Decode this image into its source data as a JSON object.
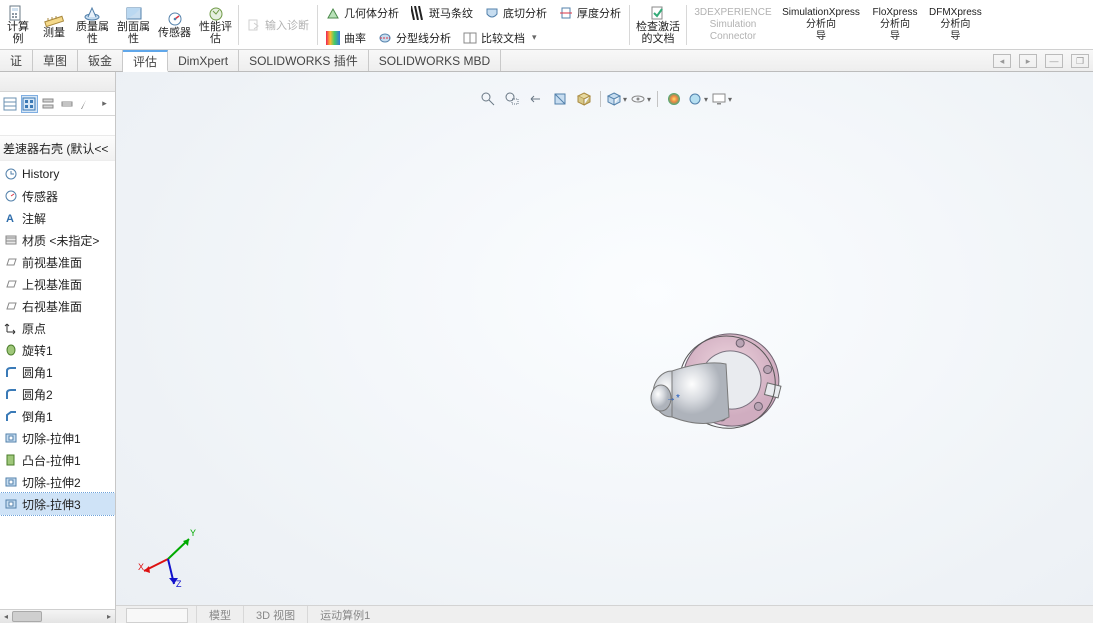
{
  "ribbon": {
    "items": [
      {
        "label": "计算\n例",
        "icon": "calc"
      },
      {
        "label": "测量",
        "icon": "measure"
      },
      {
        "label": "质量属\n性",
        "icon": "massprops"
      },
      {
        "label": "剖面属\n性",
        "icon": "sectionprops"
      },
      {
        "label": "传感器",
        "icon": "sensor"
      },
      {
        "label": "性能评\n估",
        "icon": "performance"
      }
    ],
    "input_diag": "输入诊断",
    "geom": "几何体分析",
    "zebra": "斑马条纹",
    "undercut": "底切分析",
    "thickness": "厚度分析",
    "curvature": "曲率",
    "partingline": "分型线分析",
    "compare": "比较文档",
    "check_doc": "检查激活\n的文档",
    "threeDX": {
      "l1": "3DEXPERIENCE",
      "l2": "Simulation",
      "l3": "Connector"
    },
    "simx": {
      "l1": "SimulationXpress",
      "l2": "分析向",
      "l3": "导"
    },
    "flox": {
      "l1": "FloXpress",
      "l2": "分析向",
      "l3": "导"
    },
    "dfmx": {
      "l1": "DFMXpress",
      "l2": "分析向",
      "l3": "导"
    }
  },
  "cm_tabs": [
    "证",
    "草图",
    "钣金",
    "评估",
    "DimXpert",
    "SOLIDWORKS 插件",
    "SOLIDWORKS MBD"
  ],
  "cm_active": 3,
  "tree": {
    "title": "差速器右壳  (默认<<",
    "items": [
      {
        "icon": "history",
        "label": "History"
      },
      {
        "icon": "sensor",
        "label": "传感器"
      },
      {
        "icon": "annotation",
        "label": "注解"
      },
      {
        "icon": "material",
        "label": "材质 <未指定>"
      },
      {
        "icon": "plane",
        "label": "前视基准面"
      },
      {
        "icon": "plane",
        "label": "上视基准面"
      },
      {
        "icon": "plane",
        "label": "右视基准面"
      },
      {
        "icon": "origin",
        "label": "原点"
      },
      {
        "icon": "revolve",
        "label": "旋转1"
      },
      {
        "icon": "fillet",
        "label": "圆角1"
      },
      {
        "icon": "fillet",
        "label": "圆角2"
      },
      {
        "icon": "chamfer",
        "label": "倒角1"
      },
      {
        "icon": "cutextrude",
        "label": "切除-拉伸1"
      },
      {
        "icon": "bossextrude",
        "label": "凸台-拉伸1"
      },
      {
        "icon": "cutextrude",
        "label": "切除-拉伸2"
      },
      {
        "icon": "cutextrude",
        "label": "切除-拉伸3"
      }
    ],
    "selected": 15
  },
  "bottom": [
    "模型",
    "3D 视图",
    "运动算例1"
  ],
  "triad": {
    "x": "X",
    "y": "Y",
    "z": "Z"
  }
}
